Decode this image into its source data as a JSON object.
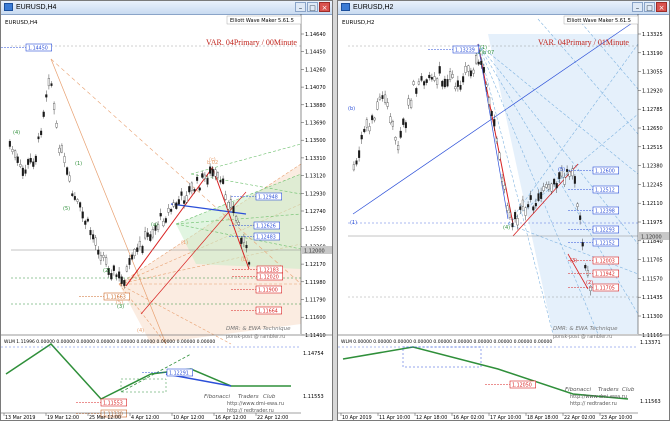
{
  "windows": {
    "left": {
      "title": "EURUSD,H4",
      "symbol": "EURUSD,H4",
      "indicator": "Elliott Wave Maker 5.61.5",
      "variant": "VAR. 04Primary / 00Minute",
      "price_ticks": [
        "1.14640",
        "1.14450",
        "1.14260",
        "1.14070",
        "1.13880",
        "1.13690",
        "1.13500",
        "1.13310",
        "1.13120",
        "1.12930",
        "1.12740",
        "1.12550",
        "1.12360",
        "1.12170",
        "1.11980",
        "1.11790",
        "1.11600",
        "1.11410"
      ],
      "current_price": "1.12000",
      "price_boxes": [
        {
          "label": "1.14450",
          "color": "#2b4fd8"
        },
        {
          "label": "1.12948",
          "color": "#2b4fd8"
        },
        {
          "label": "1.12626",
          "color": "#2b4fd8"
        },
        {
          "label": "1.12483",
          "color": "#2b4fd8"
        },
        {
          "label": "1.12183",
          "color": "#d82020"
        },
        {
          "label": "1.12020",
          "color": "#d82020"
        },
        {
          "label": "1.11900",
          "color": "#d82020"
        },
        {
          "label": "1.11664",
          "color": "#d82020"
        },
        {
          "label": "1.11663",
          "color": "#cc6a2a"
        },
        {
          "label": "1.11330",
          "color": "#cc6a2a"
        }
      ],
      "wave_labels": [
        "(4)",
        "(5)",
        "(1)",
        "(2)",
        "(3)",
        "(4)",
        "(5)",
        "(a)",
        "(b)",
        "(c)",
        "b 02",
        "(1)"
      ],
      "sub_header": "WLM 1.11996 0.00000 0.00000 0.00000 0.00000 0.00000 0.00000 0.00000 0.00000 0.00000",
      "sub_ticks": [
        "1.14754",
        "1.11553"
      ],
      "sub_price_boxes": [
        {
          "label": "1.12291",
          "color": "#2b4fd8"
        },
        {
          "label": "1.11553",
          "color": "#d82020"
        }
      ],
      "watermark_top": [
        "DMR: & EWA Technique",
        "ponsk-post @ rambler.ru"
      ],
      "watermark_bottom": [
        "Fibonacci",
        "Traders",
        "Club",
        "http://www.dmi-ewa.ru",
        "http:// redtrader.ru"
      ],
      "time_ticks": [
        "13 Mar 2019",
        "19 Mar 12:00",
        "25 Mar 12:00",
        "4 Apr 12:00",
        "10 Apr 12:00",
        "16 Apr 12:00",
        "22 Apr 12:00"
      ]
    },
    "right": {
      "title": "EURUSD,H2",
      "symbol": "EURUSD,H2",
      "indicator": "Elliott Wave Maker 5.61.5",
      "variant": "VAR. 04Primary / 01Minute",
      "price_ticks": [
        "1.13325",
        "1.13190",
        "1.13055",
        "1.12920",
        "1.12785",
        "1.12650",
        "1.12515",
        "1.12380",
        "1.12245",
        "1.12110",
        "1.11975",
        "1.11840",
        "1.11705",
        "1.11570",
        "1.11435",
        "1.11300",
        "1.11165"
      ],
      "current_price": "1.12000",
      "price_boxes": [
        {
          "label": "1.13239",
          "color": "#2b4fd8"
        },
        {
          "label": "1.12600",
          "color": "#2b4fd8"
        },
        {
          "label": "1.12512",
          "color": "#2b4fd8"
        },
        {
          "label": "1.12398",
          "color": "#2b4fd8"
        },
        {
          "label": "1.12293",
          "color": "#2b4fd8"
        },
        {
          "label": "1.12152",
          "color": "#2b4fd8"
        },
        {
          "label": "1.12003",
          "color": "#d82020"
        },
        {
          "label": "1.11942",
          "color": "#d82020"
        },
        {
          "label": "1.11705",
          "color": "#d82020"
        }
      ],
      "wave_labels": [
        "(b)",
        "(1)",
        "(2)",
        "(4)",
        "(5)",
        "(1)",
        "(2)",
        "(3)",
        "b 07"
      ],
      "sub_header": "WLM 0.00000 0.00000 0.00000 0.00000 0.00000 0.00000 0.00000 0.00000 0.00000 0.00000",
      "sub_ticks": [
        "1.13371",
        "1.11563"
      ],
      "sub_price_boxes": [
        {
          "label": "1.12050",
          "color": "#d82020"
        }
      ],
      "watermark_top": [
        "DMR: & EWA Technique",
        "ponsk-post @ rambler.ru"
      ],
      "watermark_bottom": [
        "Fibonacci",
        "Traders",
        "Club",
        "http://www.dmi-ewa.ru",
        "http:// redtrader.ru"
      ],
      "time_ticks": [
        "10 Apr 2019",
        "11 Apr 10:00",
        "12 Apr 18:00",
        "16 Apr 02:00",
        "17 Apr 10:00",
        "18 Apr 18:00",
        "22 Apr 02:00",
        "23 Apr 10:00"
      ]
    }
  },
  "colors": {
    "bull_candle": "#1a1a1a",
    "wave_green": "#2f8f3a",
    "fan_orange": "#e8a070",
    "fan_green": "#9fd59f",
    "fan_blue": "#9cc7ea",
    "line_red": "#d82020",
    "line_blue": "#2b4fd8",
    "variant_red": "#c0241c"
  }
}
